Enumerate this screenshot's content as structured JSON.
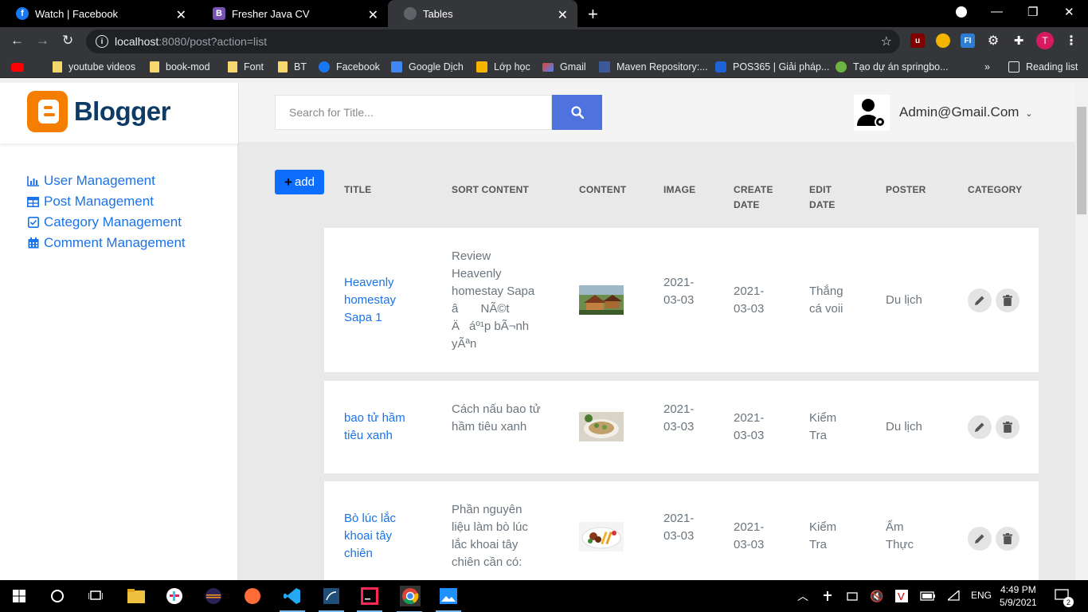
{
  "browser": {
    "tabs": [
      {
        "title": "Watch | Facebook",
        "icon": "facebook-icon"
      },
      {
        "title": "Fresher Java CV",
        "icon": "bootstrap-icon"
      },
      {
        "title": "Tables",
        "icon": "globe-icon"
      }
    ],
    "url_host": "localhost",
    "url_rest": ":8080/post?action=list",
    "bookmarks": [
      "youtube videos",
      "book-mod",
      "Font",
      "BT",
      "Facebook",
      "Google Dịch",
      "Lớp học",
      "Gmail",
      "Maven Repository:...",
      "POS365 | Giải pháp...",
      "Tạo dự án springbo...",
      "Reading list"
    ],
    "profile_initial": "T"
  },
  "brand": {
    "name": "Blogger"
  },
  "sidebar": {
    "items": [
      {
        "label": "User Management"
      },
      {
        "label": "Post Management"
      },
      {
        "label": "Category Management"
      },
      {
        "label": "Comment Management"
      }
    ]
  },
  "search": {
    "placeholder": "Search for Title..."
  },
  "user": {
    "email": "Admin@Gmail.Com"
  },
  "table": {
    "add_label": "add",
    "headers": {
      "title": "TITLE",
      "sort_content": "SORT CONTENT",
      "content": "CONTENT",
      "image": "IMAGE",
      "create_date": "CREATE DATE",
      "edit_date": "EDIT DATE",
      "poster": "POSTER",
      "category": "CATEGORY"
    },
    "rows": [
      {
        "title": "Heavenly homestay Sapa 1",
        "sort_content": "Review Heavenly homestay Sapa â NÃ©t Äáº¹p bÃ¬nh yÃªn",
        "create_date": "2021-03-03",
        "edit_date": "2021-03-03",
        "poster": "Thắng cá voii",
        "category": "Du lịch"
      },
      {
        "title": "bao tử hầm tiêu xanh",
        "sort_content": "Cách nấu bao tử hầm tiêu xanh",
        "create_date": "2021-03-03",
        "edit_date": "2021-03-03",
        "poster": "Kiểm Tra",
        "category": "Du lịch"
      },
      {
        "title": "Bò lúc lắc khoai tây chiên",
        "sort_content": "Phần nguyên liệu làm bò lúc lắc khoai tây chiên cần có:",
        "create_date": "2021-03-03",
        "edit_date": "2021-03-03",
        "poster": "Kiểm Tra",
        "category": "Ẩm Thực"
      }
    ]
  },
  "taskbar": {
    "language": "ENG",
    "time": "4:49 PM",
    "date": "5/9/2021",
    "notifications": "2"
  },
  "colors": {
    "accent": "#4e73df",
    "link": "#1a73e8",
    "add_button": "#0d6efd",
    "blogger_orange": "#f57d00"
  }
}
